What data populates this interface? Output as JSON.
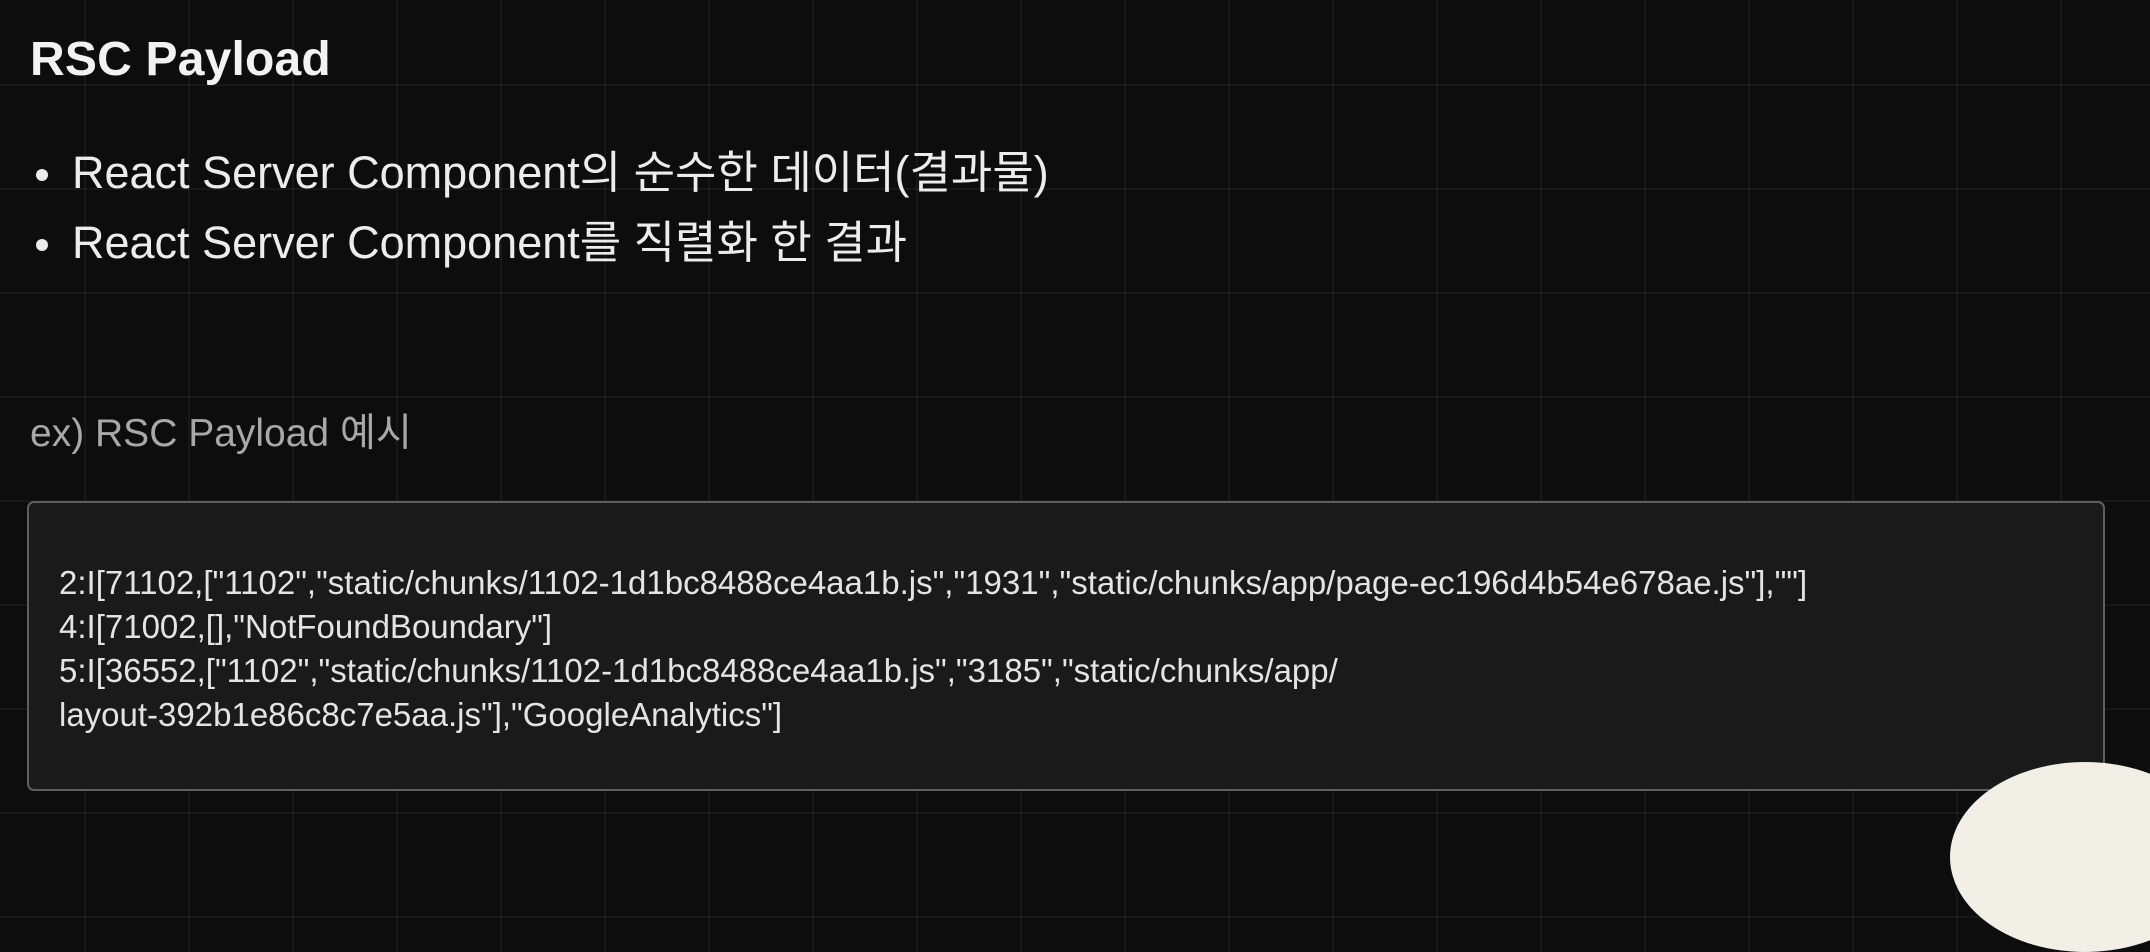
{
  "slide": {
    "title": "RSC Payload",
    "bullets": [
      "React Server Component의 순수한 데이터(결과물)",
      "React Server Component를 직렬화 한 결과"
    ],
    "example_label": "ex) RSC Payload 예시",
    "code_lines": [
      "2:I[71102,[\"1102\",\"static/chunks/1102-1d1bc8488ce4aa1b.js\",\"1931\",\"static/chunks/app/page-ec196d4b54e678ae.js\"],\"\"]",
      "4:I[71002,[],\"NotFoundBoundary\"]",
      "5:I[36552,[\"1102\",\"static/chunks/1102-1d1bc8488ce4aa1b.js\",\"3185\",\"static/chunks/app/",
      "layout-392b1e86c8c7e5aa.js\"],\"GoogleAnalytics\"]"
    ]
  }
}
